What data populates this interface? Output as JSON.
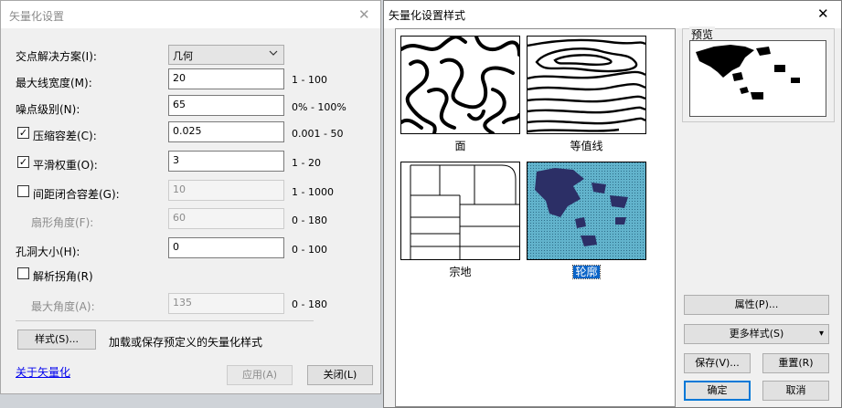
{
  "dialog1": {
    "title": "矢量化设置",
    "close_glyph": "✕",
    "intersection": {
      "label": "交点解决方案(I):",
      "value": "几何"
    },
    "max_width": {
      "label": "最大线宽度(M):",
      "value": "20",
      "range": "1 - 100"
    },
    "noise": {
      "label": "噪点级别(N):",
      "value": "65",
      "range": "0% - 100%"
    },
    "compression": {
      "label": "压缩容差(C):",
      "checked": true,
      "value": "0.025",
      "range": "0.001 - 50"
    },
    "smoothing": {
      "label": "平滑权重(O):",
      "checked": true,
      "value": "3",
      "range": "1 - 20"
    },
    "gap": {
      "label": "间距闭合容差(G):",
      "checked": false,
      "value": "10",
      "range": "1 - 1000"
    },
    "fan_angle": {
      "label": "扇形角度(F):",
      "value": "60",
      "range": "0 - 180"
    },
    "hole_size": {
      "label": "孔洞大小(H):",
      "value": "0",
      "range": "0 - 100"
    },
    "resolve_corners": {
      "label": "解析拐角(R)",
      "checked": false
    },
    "max_angle": {
      "label": "最大角度(A):",
      "value": "135",
      "range": "0 - 180"
    },
    "styles_button": "样式(S)...",
    "styles_desc": "加载或保存预定义的矢量化样式",
    "about_link": "关于矢量化",
    "apply_button": "应用(A)",
    "close_button": "关闭(L)"
  },
  "dialog2": {
    "title": "矢量化设置样式",
    "close_glyph": "✕",
    "styles": [
      {
        "label": "面",
        "selected": false
      },
      {
        "label": "等值线",
        "selected": false
      },
      {
        "label": "宗地",
        "selected": false
      },
      {
        "label": "轮廓",
        "selected": true
      }
    ],
    "preview_label": "预览",
    "properties_button": "属性(P)...",
    "more_styles_button": "更多样式(S)",
    "more_styles_chevron": "▾",
    "save_button": "保存(V)...",
    "reset_button": "重置(R)",
    "ok_button": "确定",
    "cancel_button": "取消"
  }
}
